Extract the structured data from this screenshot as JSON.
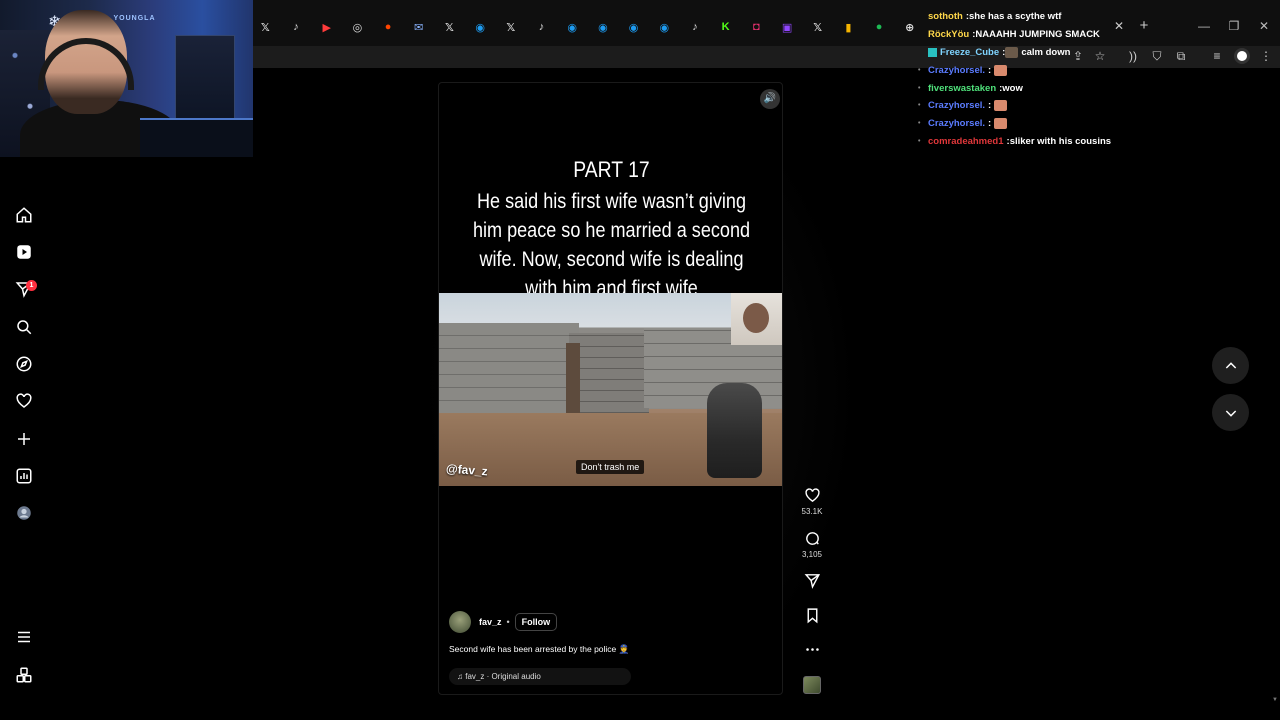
{
  "browser": {
    "tabs": [
      {
        "icon": "x-icon",
        "glyph": "𝕏",
        "color": "#dddddd"
      },
      {
        "icon": "tiktok-icon",
        "glyph": "♪",
        "color": "#dddddd"
      },
      {
        "icon": "youtube-icon",
        "glyph": "▶",
        "color": "#ff3b3b"
      },
      {
        "icon": "chatgpt-icon",
        "glyph": "◎",
        "color": "#dddddd"
      },
      {
        "icon": "reddit-icon",
        "glyph": "●",
        "color": "#ff4500"
      },
      {
        "icon": "mail-icon",
        "glyph": "✉",
        "color": "#8ab4ff"
      },
      {
        "icon": "x-icon",
        "glyph": "𝕏",
        "color": "#dddddd"
      },
      {
        "icon": "site-icon",
        "glyph": "◉",
        "color": "#1d9bf0"
      },
      {
        "icon": "x-icon",
        "glyph": "𝕏",
        "color": "#dddddd"
      },
      {
        "icon": "tiktok-icon",
        "glyph": "♪",
        "color": "#dddddd"
      },
      {
        "icon": "site-icon",
        "glyph": "◉",
        "color": "#1d9bf0"
      },
      {
        "icon": "site-icon",
        "glyph": "◉",
        "color": "#1d9bf0"
      },
      {
        "icon": "site-icon",
        "glyph": "◉",
        "color": "#1d9bf0"
      },
      {
        "icon": "site-icon",
        "glyph": "◉",
        "color": "#1d9bf0"
      },
      {
        "icon": "tiktok-icon",
        "glyph": "♪",
        "color": "#dddddd"
      },
      {
        "icon": "kick-icon",
        "glyph": "K",
        "color": "#53fc18"
      },
      {
        "icon": "instagram-icon",
        "glyph": "◘",
        "color": "#e1306c"
      },
      {
        "icon": "twitch-icon",
        "glyph": "▣",
        "color": "#9146ff"
      },
      {
        "icon": "x-icon",
        "glyph": "𝕏",
        "color": "#dddddd"
      },
      {
        "icon": "chart-icon",
        "glyph": "▮",
        "color": "#f5b400"
      },
      {
        "icon": "spotify-icon",
        "glyph": "●",
        "color": "#1db954"
      },
      {
        "icon": "globe-icon",
        "glyph": "⊕",
        "color": "#dddddd"
      }
    ],
    "close_glyph": "✕",
    "new_tab_glyph": "+",
    "minimize_glyph": "—",
    "restore_glyph": "❐",
    "window_close_glyph": "✕"
  },
  "webcam": {
    "sign_text": "YOUNGLA"
  },
  "sidebar": {
    "notification_count": "1"
  },
  "reel": {
    "part_label": "PART 17",
    "caption_lines": [
      "He said his first wife wasn’t giving",
      "him peace so he married a second",
      "wife. Now, second wife is dealing",
      "with him and first wife"
    ],
    "watermark": "@fav_z",
    "subtitle": "Don't trash me",
    "author": "fav_z",
    "separator": "•",
    "follow_label": "Follow",
    "post_caption": "Second wife has been arrested by the police 👮",
    "audio_label": "♫ fav_z · Original audio"
  },
  "actions": {
    "likes": "53.1K",
    "comments": "3,105"
  },
  "chat": [
    {
      "user": "sothoth",
      "user_color": "#ffd84a",
      "message": "she has a scythe wtf",
      "prefix": ""
    },
    {
      "user": "RöckYöu",
      "user_color": "#ffd84a",
      "message": "NAAAHH JUMPING SMACK",
      "prefix": ""
    },
    {
      "user": "Freeze_Cube",
      "user_color": "#7fd4ff",
      "message": "calm down",
      "prefix": ""
    },
    {
      "user": "Crazyhorsel.",
      "user_color": "#5b7cff",
      "message": "",
      "prefix": "•"
    },
    {
      "user": "fiverswastaken",
      "user_color": "#4fe07a",
      "message": "wow",
      "prefix": "•"
    },
    {
      "user": "Crazyhorsel.",
      "user_color": "#5b7cff",
      "message": "",
      "prefix": "•"
    },
    {
      "user": "Crazyhorsel.",
      "user_color": "#5b7cff",
      "message": "",
      "prefix": "•"
    },
    {
      "user": "comradeahmed1",
      "user_color": "#e0373a",
      "message": "sliker with his cousins",
      "prefix": "•"
    }
  ]
}
